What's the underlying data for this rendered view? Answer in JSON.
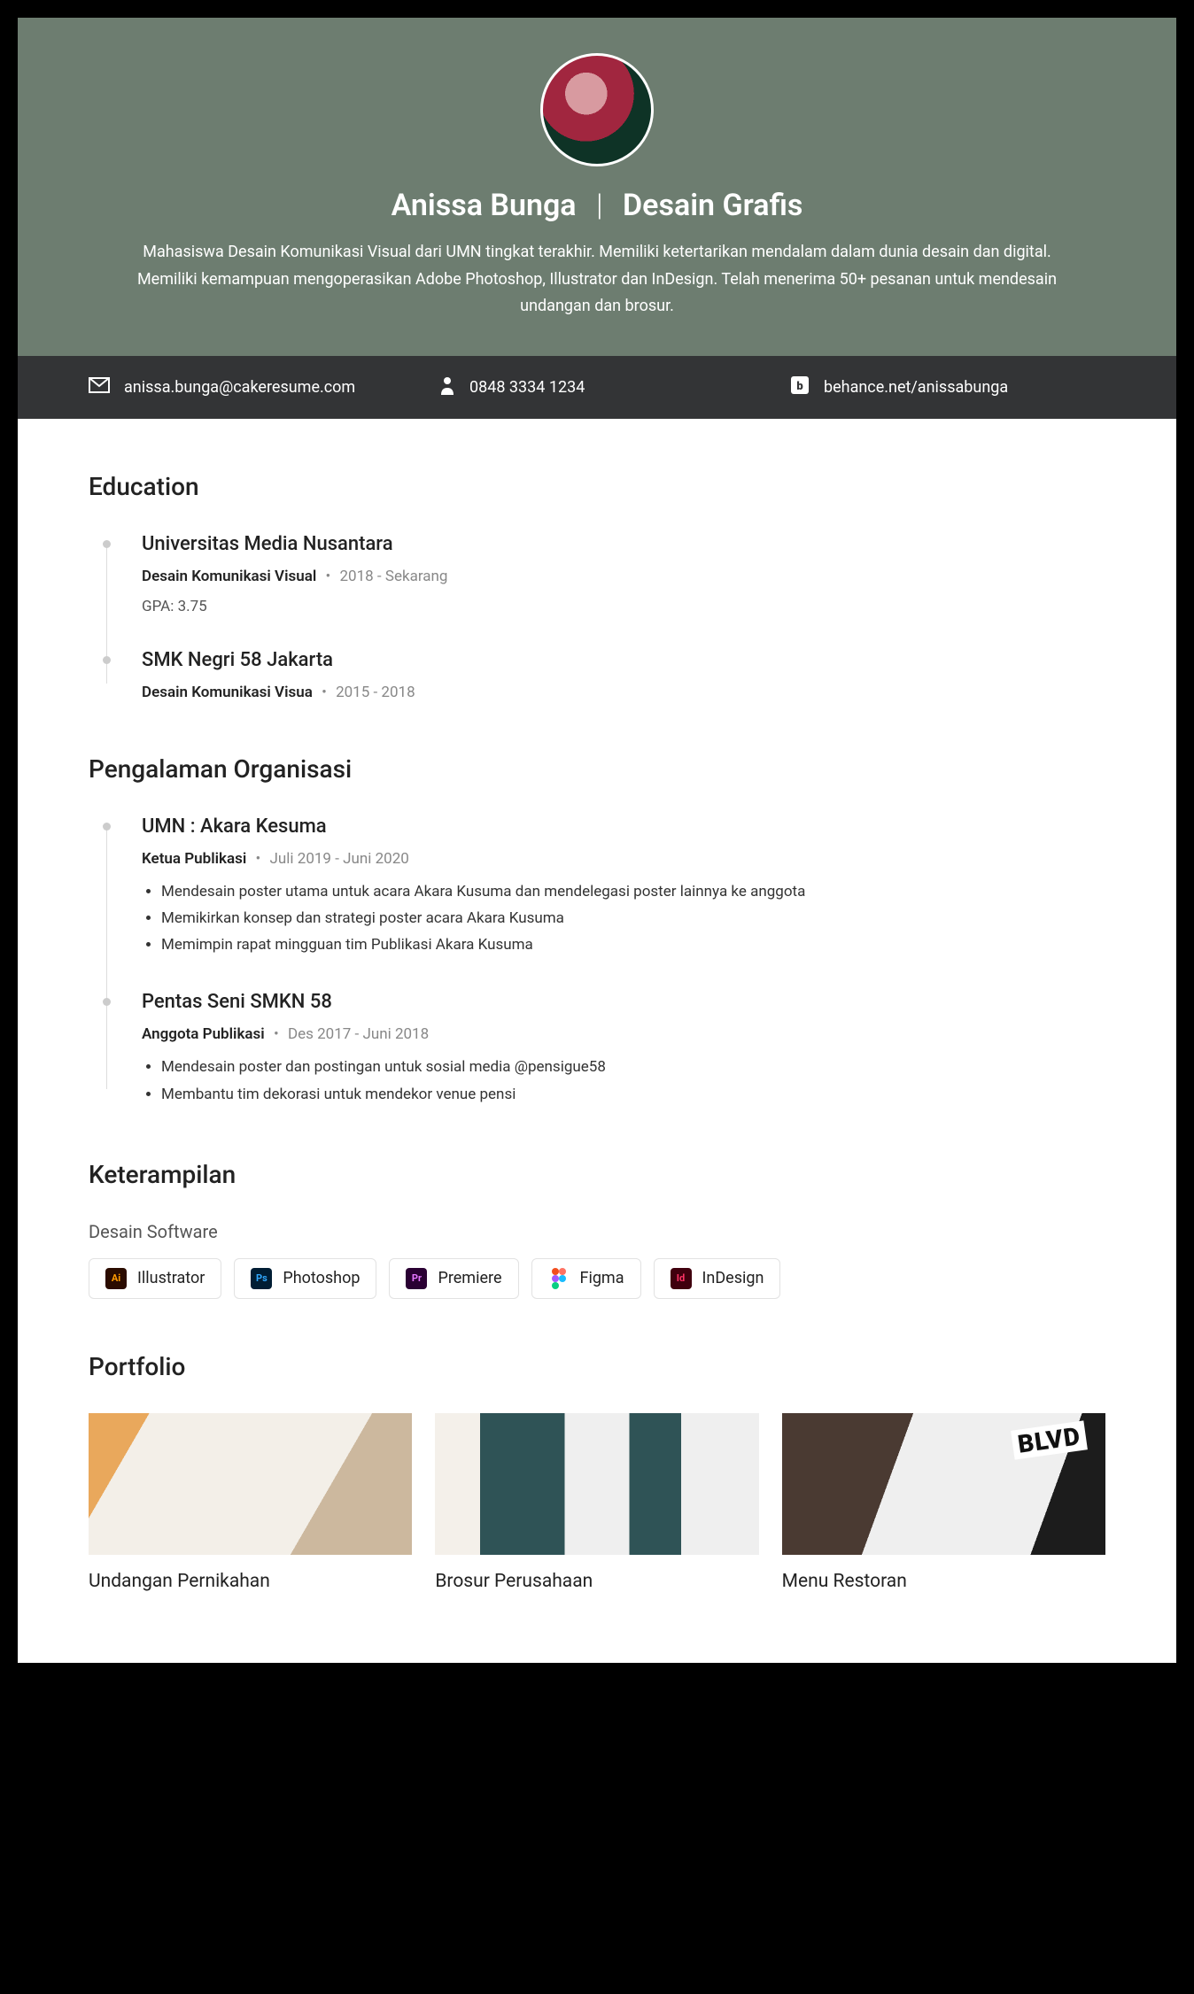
{
  "header": {
    "name": "Anissa Bunga",
    "role": "Desain Grafis",
    "summary": "Mahasiswa Desain Komunikasi Visual dari UMN tingkat terakhir. Memiliki ketertarikan mendalam dalam dunia desain dan digital. Memiliki kemampuan mengoperasikan Adobe Photoshop, Illustrator dan InDesign. Telah menerima 50+ pesanan untuk mendesain undangan dan brosur."
  },
  "contact": {
    "email": "anissa.bunga@cakeresume.com",
    "phone": "0848 3334 1234",
    "behance": "behance.net/anissabunga"
  },
  "sections": {
    "education_title": "Education",
    "experience_title": "Pengalaman Organisasi",
    "skills_title": "Keterampilan",
    "skills_sub": "Desain Software",
    "portfolio_title": "Portfolio"
  },
  "education": [
    {
      "school": "Universitas Media Nusantara",
      "program": "Desain Komunikasi Visual",
      "dates": "2018 - Sekarang",
      "extra": "GPA: 3.75"
    },
    {
      "school": "SMK Negri 58 Jakarta",
      "program": "Desain Komunikasi Visua",
      "dates": "2015 - 2018",
      "extra": ""
    }
  ],
  "experience": [
    {
      "org": "UMN : Akara Kesuma",
      "role": "Ketua Publikasi",
      "dates": "Juli 2019 - Juni 2020",
      "bullets": [
        "Mendesain poster utama untuk acara Akara Kusuma dan mendelegasi poster lainnya ke anggota",
        "Memikirkan konsep dan strategi poster acara Akara Kusuma",
        "Memimpin rapat mingguan tim Publikasi Akara Kusuma"
      ]
    },
    {
      "org": "Pentas Seni SMKN 58",
      "role": "Anggota Publikasi",
      "dates": "Des 2017 - Juni 2018",
      "bullets": [
        "Mendesain poster dan postingan untuk sosial media @pensigue58",
        "Membantu tim dekorasi untuk mendekor venue pensi"
      ]
    }
  ],
  "skills": [
    {
      "icon": "Ai",
      "label": "Illustrator",
      "cls": "sk-ai"
    },
    {
      "icon": "Ps",
      "label": "Photoshop",
      "cls": "sk-ps"
    },
    {
      "icon": "Pr",
      "label": "Premiere",
      "cls": "sk-pr"
    },
    {
      "icon": "Fg",
      "label": "Figma",
      "cls": "sk-fg"
    },
    {
      "icon": "Id",
      "label": "InDesign",
      "cls": "sk-id"
    }
  ],
  "portfolio": [
    {
      "title": "Undangan Pernikahan",
      "cls": "p1"
    },
    {
      "title": "Brosur Perusahaan",
      "cls": "p2"
    },
    {
      "title": "Menu Restoran",
      "cls": "p3"
    }
  ]
}
